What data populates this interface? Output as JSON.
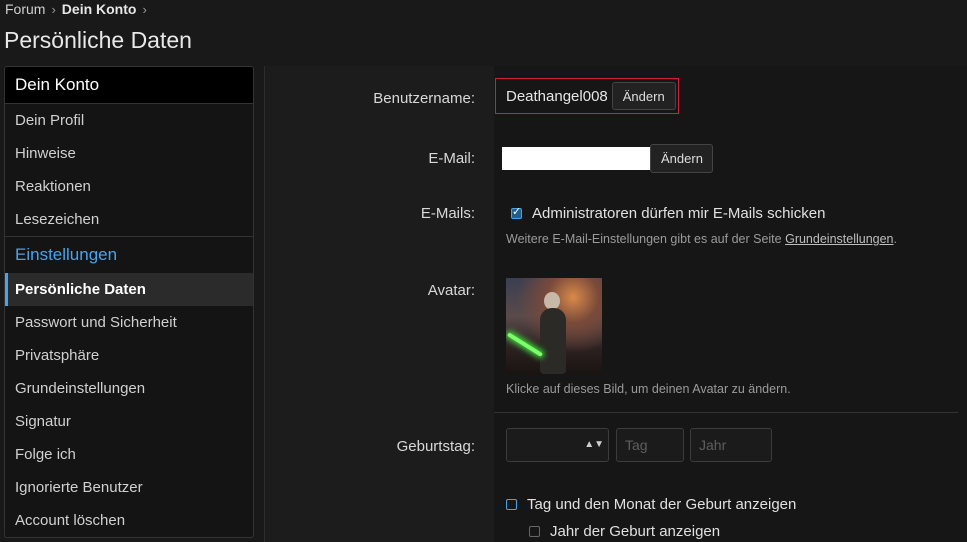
{
  "breadcrumb": {
    "items": [
      "Forum",
      "Dein Konto"
    ]
  },
  "page_title": "Persönliche Daten",
  "sidebar": {
    "header": "Dein Konto",
    "items": [
      "Dein Profil",
      "Hinweise",
      "Reaktionen",
      "Lesezeichen"
    ],
    "section": "Einstellungen",
    "settings_items": [
      "Persönliche Daten",
      "Passwort und Sicherheit",
      "Privatsphäre",
      "Grundeinstellungen",
      "Signatur",
      "Folge ich",
      "Ignorierte Benutzer",
      "Account löschen"
    ],
    "active": "Persönliche Daten"
  },
  "form": {
    "username_label": "Benutzername:",
    "username_value": "Deathangel008",
    "change_label": "Ändern",
    "email_label": "E-Mail:",
    "email_value": "",
    "emails_label": "E-Mails:",
    "emails_checkbox": "Administratoren dürfen mir E-Mails schicken",
    "emails_hint_prefix": "Weitere E-Mail-Einstellungen gibt es auf der Seite",
    "emails_hint_link": "Grundeinstellungen",
    "emails_hint_suffix": ".",
    "avatar_label": "Avatar:",
    "avatar_hint": "Klicke auf dieses Bild, um deinen Avatar zu ändern.",
    "birthday_label": "Geburtstag:",
    "day_placeholder": "Tag",
    "year_placeholder": "Jahr",
    "show_day_month": "Tag und den Monat der Geburt anzeigen",
    "show_year": "Jahr der Geburt anzeigen"
  },
  "colors": {
    "accent": "#4aa3e8",
    "highlight_border": "#d0213a",
    "background": "#191919"
  }
}
